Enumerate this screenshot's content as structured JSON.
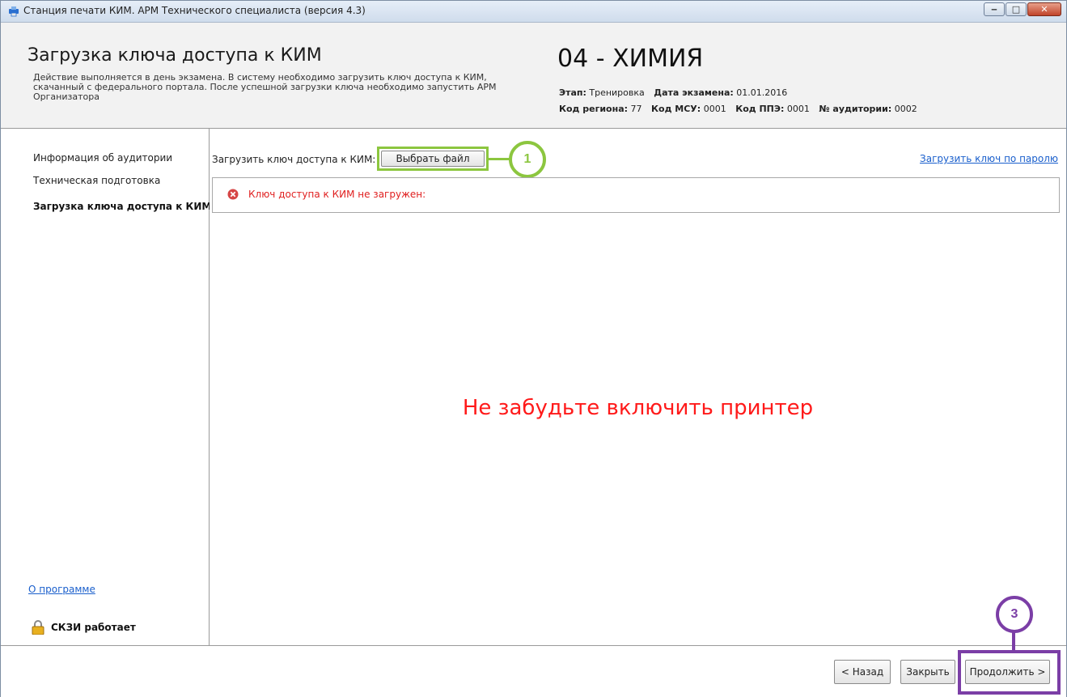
{
  "window": {
    "title": "Станция печати КИМ. АРМ Технического специалиста (версия 4.3)",
    "controls": {
      "minimize": "‒",
      "maximize": "□",
      "close": "✕"
    }
  },
  "header": {
    "title": "Загрузка ключа доступа к КИМ",
    "description": "Действие выполняется в день экзамена. В систему необходимо загрузить ключ доступа к КИМ, скачанный с федерального портала. После успешной загрузки ключа необходимо запустить АРМ Организатора",
    "subject": "04 - ХИМИЯ",
    "stage_label": "Этап:",
    "stage_value": "Тренировка",
    "exam_date_label": "Дата экзамена:",
    "exam_date_value": "01.01.2016",
    "region_label": "Код региона:",
    "region_value": "77",
    "msu_label": "Код МСУ:",
    "msu_value": "0001",
    "ppe_label": "Код ППЭ:",
    "ppe_value": "0001",
    "room_label": "№ аудитории:",
    "room_value": "0002"
  },
  "sidebar": {
    "items": [
      {
        "label": "Информация об аудитории",
        "active": false
      },
      {
        "label": "Техническая подготовка",
        "active": false
      },
      {
        "label": "Загрузка ключа доступа к КИМ",
        "active": true
      }
    ],
    "about_link": "О программе",
    "skzi_status": "СКЗИ работает"
  },
  "main": {
    "load_key_label": "Загрузить ключ доступа к КИМ:",
    "choose_file_button": "Выбрать файл",
    "password_link": "Загрузить ключ по паролю",
    "status_text": "Ключ доступа к КИМ не загружен:",
    "printer_reminder": "Не забудьте включить принтер"
  },
  "footer": {
    "back_button": "< Назад",
    "close_button": "Закрыть",
    "next_button": "Продолжить >"
  },
  "callouts": {
    "one": "1",
    "three": "3"
  },
  "colors": {
    "callout_green": "#8cc63f",
    "callout_purple": "#7b3ea6",
    "error_red": "#e02020",
    "link_blue": "#1a5fcc"
  },
  "icons": {
    "app": "app-icon",
    "error": "error-icon",
    "lock": "lock-icon"
  }
}
